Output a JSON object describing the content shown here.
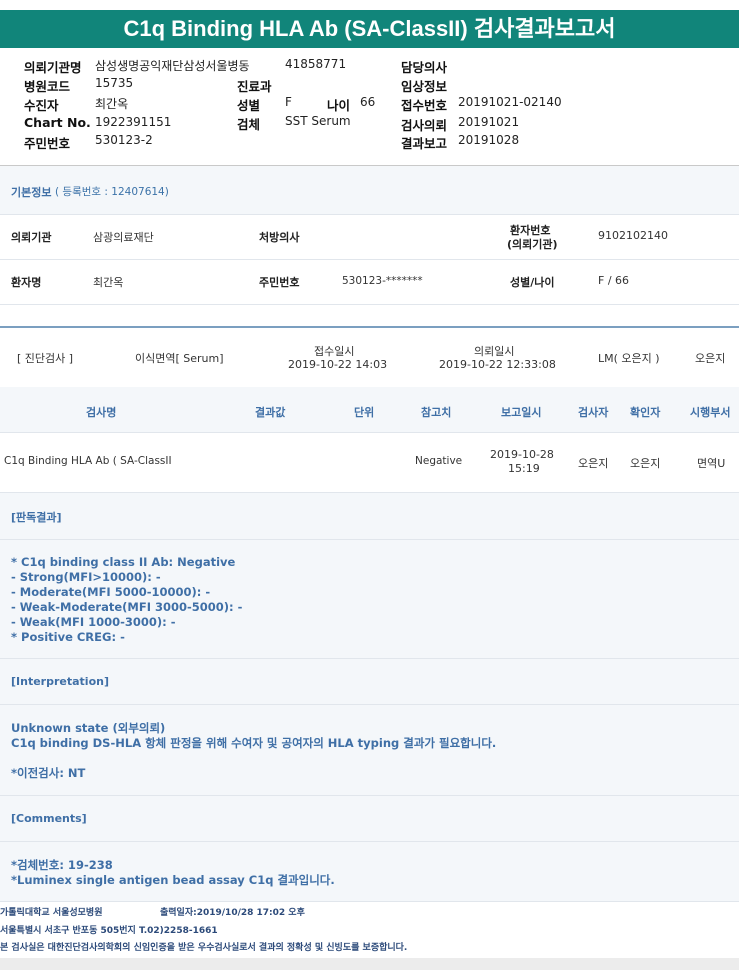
{
  "title": "C1q Binding HLA Ab (SA-ClassII) 검사결과보고서",
  "header": {
    "req_org_label": "의뢰기관명",
    "req_org_value": "삼성생명공익재단삼성서울병동",
    "code1": "41858771",
    "doctor_label": "담당의사",
    "hosp_code_label": "병원코드",
    "hosp_code_value": "15735",
    "dept_label": "진료과",
    "clinical_label": "임상정보",
    "collector_label": "수진자",
    "collector_value": "최간옥",
    "sex_label": "성별",
    "sex_value": "F",
    "age_label": "나이",
    "age_value": "66",
    "receipt_label": "접수번호",
    "receipt_value": "20191021-02140",
    "chart_label": "Chart No.",
    "chart_value": "1922391151",
    "specimen_label": "검체",
    "specimen_value": "SST Serum",
    "request_label": "검사의뢰",
    "request_value": "20191021",
    "rrn_label": "주민번호",
    "rrn_value": "530123-2",
    "report_label": "결과보고",
    "report_value": "20191028"
  },
  "basic_info": {
    "heading": "기본정보",
    "reg_no": "( 등록번호 : 12407614)",
    "inst_label": "의뢰기관",
    "inst_value": "삼광의료재단",
    "presc_label": "처방의사",
    "patno_label_1": "환자번호",
    "patno_label_2": "(의뢰기관)",
    "patno_value": "9102102140",
    "name_label": "환자명",
    "name_value": "최간옥",
    "rrn_label": "주민번호",
    "rrn_value": "530123-*******",
    "sexage_label": "성별/나이",
    "sexage_value": "F / 66"
  },
  "exam": {
    "type": "[ 진단검사 ]",
    "specimen": "이식면역[ Serum]",
    "recv_label": "접수일시",
    "recv_value": "2019-10-22 14:03",
    "req_label": "의뢰일시",
    "req_value": "2019-10-22 12:33:08",
    "lm": "LM( 오은지 )",
    "person": "오은지"
  },
  "table": {
    "headers": [
      "검사명",
      "결과값",
      "단위",
      "참고치",
      "보고일시",
      "검사자",
      "확인자",
      "시행부서"
    ],
    "row": {
      "name": "C1q Binding HLA Ab ( SA-ClassII",
      "result": "",
      "unit": "",
      "ref": "Negative",
      "date1": "2019-10-28",
      "date2": "15:19",
      "tester": "오은지",
      "confirmer": "오은지",
      "dept": "면역U"
    }
  },
  "sections": {
    "judgement_heading": "[판독결과]",
    "judgement_lines": [
      "* C1q binding class II Ab: Negative",
      "- Strong(MFI>10000): -",
      "- Moderate(MFI 5000-10000): -",
      "- Weak-Moderate(MFI 3000-5000): -",
      "- Weak(MFI 1000-3000): -",
      "* Positive CREG: -"
    ],
    "interp_heading": "[Interpretation]",
    "interp_lines": [
      "Unknown state (외부의뢰)",
      "C1q binding DS-HLA 항체 판정을 위해 수여자 및 공여자의 HLA typing 결과가 필요합니다."
    ],
    "prior_test": "*이전검사: NT",
    "comments_heading": "[Comments]",
    "comments_lines": [
      "*검체번호: 19-238",
      "*Luminex single antigen bead assay C1q 결과입니다."
    ]
  },
  "footer": {
    "line1_org": "가톨릭대학교 서울성모병원",
    "line1_print": "출력일자:2019/10/28 17:02 오후",
    "line2": "서울특별시 서초구 반포동 505번지 T.02)2258-1661",
    "line3": "본 검사실은 대한진단검사의학회의 신임인증을 받은 우수검사실로서 결과의 정확성 및 신빙도를 보증합니다."
  }
}
